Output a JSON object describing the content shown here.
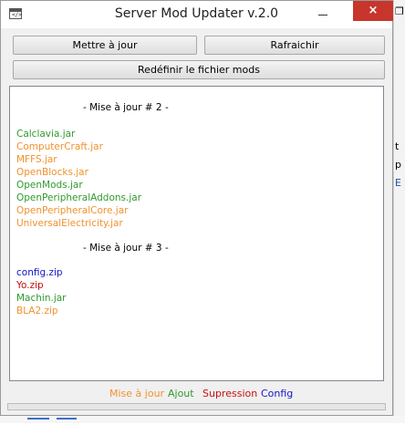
{
  "window": {
    "title": "Server Mod Updater  v.2.0",
    "icon": "app-window-icon",
    "close_glyph": "×"
  },
  "toolbar": {
    "update_label": "Mettre à jour",
    "refresh_label": "Rafraichir",
    "redefine_label": "Redéfinir le fichier mods"
  },
  "colors": {
    "update": "#f0922e",
    "add": "#2e9a2e",
    "removal": "#c81010",
    "config": "#1414c8"
  },
  "log": {
    "header1": "- Mise à jour # 2 -",
    "group1": [
      {
        "name": "Calclavia.jar",
        "type": "add"
      },
      {
        "name": "ComputerCraft.jar",
        "type": "update"
      },
      {
        "name": "MFFS.jar",
        "type": "update"
      },
      {
        "name": "OpenBlocks.jar",
        "type": "update"
      },
      {
        "name": "OpenMods.jar",
        "type": "add"
      },
      {
        "name": "OpenPeripheralAddons.jar",
        "type": "add"
      },
      {
        "name": "OpenPeripheralCore.jar",
        "type": "update"
      },
      {
        "name": "UniversalElectricity.jar",
        "type": "update"
      }
    ],
    "header2": "- Mise à jour # 3 -",
    "group2": [
      {
        "name": "config.zip",
        "type": "config"
      },
      {
        "name": "Yo.zip",
        "type": "removal"
      },
      {
        "name": "Machin.jar",
        "type": "add"
      },
      {
        "name": "BLA2.zip",
        "type": "update"
      }
    ]
  },
  "legend": {
    "update": "Mise à jour",
    "add": "Ajout",
    "removal": "Supression",
    "config": "Config"
  },
  "progress": {
    "value": 0
  },
  "background": {
    "frag_t": "t",
    "frag_p": "p",
    "frag_e": "E"
  }
}
